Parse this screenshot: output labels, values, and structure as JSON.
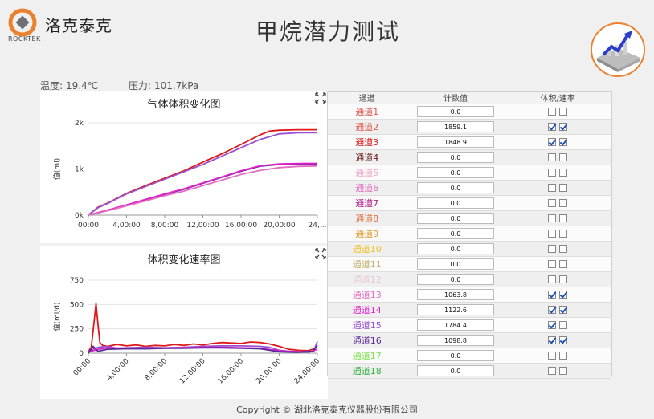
{
  "brand": {
    "name": "洛克泰克",
    "sub": "ROCKTEK"
  },
  "title": "甲烷潜力测试",
  "env": {
    "temp_label": "温度:",
    "temp_value": "19.4℃",
    "pressure_label": "压力:",
    "pressure_value": "101.7kPa"
  },
  "table": {
    "headers": [
      "通道",
      "计数值",
      "体积/速率"
    ],
    "rows": [
      {
        "name": "通道1",
        "color": "#e0554e",
        "value": "0.0",
        "vol": false,
        "rate": false
      },
      {
        "name": "通道2",
        "color": "#e0554e",
        "value": "1859.1",
        "vol": true,
        "rate": true
      },
      {
        "name": "通道3",
        "color": "#e01a1a",
        "value": "1848.9",
        "vol": true,
        "rate": true
      },
      {
        "name": "通道4",
        "color": "#6b1a1a",
        "value": "0.0",
        "vol": false,
        "rate": false
      },
      {
        "name": "通道5",
        "color": "#f2a6c8",
        "value": "0.0",
        "vol": false,
        "rate": false
      },
      {
        "name": "通道6",
        "color": "#e06fc2",
        "value": "0.0",
        "vol": false,
        "rate": false
      },
      {
        "name": "通道7",
        "color": "#b0208a",
        "value": "0.0",
        "vol": false,
        "rate": false
      },
      {
        "name": "通道8",
        "color": "#e0703e",
        "value": "0.0",
        "vol": false,
        "rate": false
      },
      {
        "name": "通道9",
        "color": "#e09a2e",
        "value": "0.0",
        "vol": false,
        "rate": false
      },
      {
        "name": "通道10",
        "color": "#f0c020",
        "value": "0.0",
        "vol": false,
        "rate": false
      },
      {
        "name": "通道11",
        "color": "#c0b070",
        "value": "0.0",
        "vol": false,
        "rate": false
      },
      {
        "name": "通道12",
        "color": "#e8c8d8",
        "value": "0.0",
        "vol": false,
        "rate": false
      },
      {
        "name": "通道13",
        "color": "#e06fc2",
        "value": "1063.8",
        "vol": true,
        "rate": true
      },
      {
        "name": "通道14",
        "color": "#e020c8",
        "value": "1122.6",
        "vol": true,
        "rate": true
      },
      {
        "name": "通道15",
        "color": "#9a50d0",
        "value": "1784.4",
        "vol": true,
        "rate": false
      },
      {
        "name": "通道16",
        "color": "#5a2a9a",
        "value": "1098.8",
        "vol": true,
        "rate": true
      },
      {
        "name": "通道17",
        "color": "#80e050",
        "value": "0.0",
        "vol": false,
        "rate": false
      },
      {
        "name": "通道18",
        "color": "#30b040",
        "value": "0.0",
        "vol": false,
        "rate": false
      }
    ]
  },
  "chart_data": [
    {
      "type": "line",
      "title": "气体体积变化图",
      "ylabel": "值(ml)",
      "xlabel": "",
      "ylim": [
        0,
        2000
      ],
      "xlim": [
        0,
        24
      ],
      "y_ticks": [
        "0k",
        "1k",
        "2k"
      ],
      "x_ticks": [
        "00:00",
        "4,00:00",
        "8,00:00",
        "12,00:00",
        "16,00:00",
        "20,00:00",
        "24,..."
      ],
      "series": [
        {
          "color": "#e01a1a",
          "x": [
            0,
            1,
            2,
            4,
            6,
            8,
            10,
            12,
            14,
            16,
            18,
            19,
            20,
            22,
            24
          ],
          "y": [
            0,
            170,
            260,
            470,
            640,
            800,
            960,
            1150,
            1330,
            1530,
            1740,
            1820,
            1840,
            1850,
            1850
          ]
        },
        {
          "color": "#9a50d0",
          "x": [
            0,
            1,
            2,
            4,
            6,
            8,
            10,
            12,
            14,
            16,
            18,
            20,
            22,
            24
          ],
          "y": [
            0,
            160,
            250,
            460,
            620,
            780,
            940,
            1100,
            1280,
            1460,
            1640,
            1760,
            1785,
            1785
          ]
        },
        {
          "color": "#5a2a9a",
          "x": [
            0,
            2,
            4,
            6,
            8,
            10,
            12,
            14,
            16,
            18,
            20,
            22,
            24
          ],
          "y": [
            0,
            100,
            210,
            330,
            450,
            560,
            690,
            820,
            950,
            1060,
            1100,
            1100,
            1100
          ]
        },
        {
          "color": "#e020c8",
          "x": [
            0,
            2,
            4,
            6,
            8,
            10,
            12,
            14,
            16,
            18,
            20,
            22,
            24
          ],
          "y": [
            0,
            110,
            220,
            340,
            460,
            570,
            700,
            830,
            960,
            1070,
            1110,
            1120,
            1122
          ]
        },
        {
          "color": "#e06fc2",
          "x": [
            0,
            2,
            4,
            6,
            8,
            10,
            12,
            14,
            16,
            18,
            20,
            22,
            24
          ],
          "y": [
            0,
            95,
            200,
            310,
            420,
            520,
            640,
            760,
            880,
            970,
            1030,
            1055,
            1064
          ]
        }
      ]
    },
    {
      "type": "line",
      "title": "体积变化速率图",
      "ylabel": "值(ml/d)",
      "xlabel": "",
      "ylim": [
        0,
        750
      ],
      "xlim": [
        0,
        24
      ],
      "y_ticks": [
        "0",
        "250",
        "500",
        "750"
      ],
      "x_ticks": [
        "00:00",
        "4,00:00",
        "8,00:00",
        "12,00:00",
        "16,00:00",
        "20,00:00",
        "24,00:00"
      ],
      "series": [
        {
          "color": "#e01a1a",
          "x": [
            0,
            0.3,
            0.6,
            0.8,
            1.0,
            1.2,
            1.5,
            2,
            3,
            4,
            5,
            6,
            7,
            8,
            9,
            10,
            11,
            12,
            13,
            14,
            15,
            16,
            17,
            18,
            19,
            20,
            21,
            22,
            23,
            23.5,
            24
          ],
          "y": [
            20,
            60,
            320,
            510,
            300,
            110,
            80,
            70,
            90,
            75,
            85,
            70,
            80,
            75,
            90,
            80,
            95,
            85,
            100,
            110,
            105,
            100,
            115,
            110,
            95,
            70,
            40,
            30,
            25,
            40,
            60
          ]
        },
        {
          "color": "#9a50d0",
          "x": [
            0,
            1,
            2,
            3,
            4,
            6,
            8,
            10,
            12,
            14,
            16,
            18,
            19,
            20,
            21,
            22,
            23,
            23.6,
            24
          ],
          "y": [
            20,
            60,
            70,
            50,
            55,
            60,
            55,
            60,
            70,
            75,
            75,
            70,
            60,
            30,
            20,
            15,
            10,
            20,
            120
          ]
        },
        {
          "color": "#e020c8",
          "x": [
            0,
            1,
            2,
            4,
            6,
            8,
            10,
            12,
            14,
            16,
            18,
            20,
            22,
            23.5,
            24
          ],
          "y": [
            10,
            40,
            55,
            50,
            45,
            50,
            55,
            60,
            60,
            55,
            50,
            25,
            15,
            20,
            40
          ]
        },
        {
          "color": "#5a2a9a",
          "x": [
            0,
            0.5,
            1,
            2,
            4,
            6,
            8,
            10,
            12,
            14,
            16,
            18,
            20,
            22,
            23.5,
            24
          ],
          "y": [
            0,
            70,
            20,
            40,
            45,
            45,
            50,
            50,
            55,
            55,
            50,
            45,
            15,
            10,
            20,
            80
          ]
        }
      ]
    }
  ],
  "footer": "Copyright © 湖北洛克泰克仪器股份有限公司"
}
